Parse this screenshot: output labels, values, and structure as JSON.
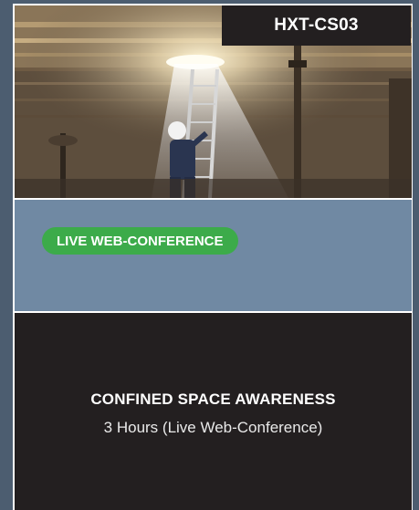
{
  "card": {
    "code": "HXT-CS03",
    "badge": "LIVE WEB-CONFERENCE",
    "title": "CONFINED SPACE AWARENESS",
    "subtitle": "3 Hours (Live Web-Conference)"
  },
  "colors": {
    "background": "#4c5d70",
    "badge": "#3cab4a",
    "panel_blue": "#7089a3",
    "panel_dark": "#231f20"
  }
}
